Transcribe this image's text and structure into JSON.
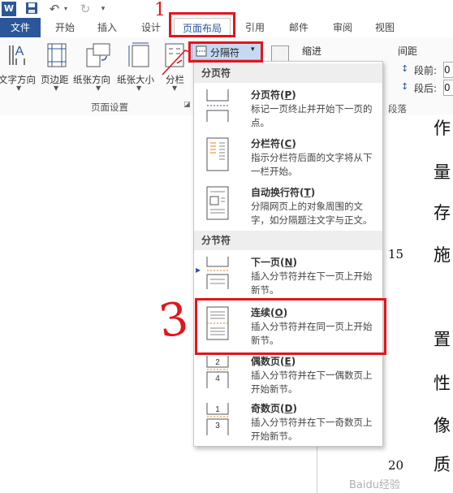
{
  "quick_access": {
    "word_icon": "word-app-icon",
    "save_icon": "save-icon",
    "undo_icon": "undo-icon",
    "redo_icon": "redo-icon",
    "customize_icon": "customize-qat-icon"
  },
  "tabs": [
    {
      "label": "文件"
    },
    {
      "label": "开始"
    },
    {
      "label": "插入"
    },
    {
      "label": "设计"
    },
    {
      "label": "页面布局"
    },
    {
      "label": "引用"
    },
    {
      "label": "邮件"
    },
    {
      "label": "审阅"
    },
    {
      "label": "视图"
    }
  ],
  "ribbon": {
    "buttons": [
      {
        "label": "文字方向",
        "icon": "text-direction-icon"
      },
      {
        "label": "页边距",
        "icon": "margins-icon"
      },
      {
        "label": "纸张方向",
        "icon": "orientation-icon"
      },
      {
        "label": "纸张大小",
        "icon": "size-icon"
      },
      {
        "label": "分栏",
        "icon": "columns-icon"
      }
    ],
    "breaks_button": "分隔符",
    "group_page_setup": "页面设置",
    "indent_label": "缩进",
    "spacing_label": "间距",
    "spacing_before_label": "段前:",
    "spacing_after_label": "段后:",
    "spacing_before_value": "0",
    "spacing_after_value": "0",
    "group_paragraph": "段落"
  },
  "menu": {
    "section_page_breaks": "分页符",
    "section_section_breaks": "分节符",
    "items": [
      {
        "title": "分页符(",
        "key": "P",
        "desc": "标记一页终止并开始下一页的点。"
      },
      {
        "title": "分栏符(",
        "key": "C",
        "desc": "指示分栏符后面的文字将从下一栏开始。"
      },
      {
        "title": "自动换行符(",
        "key": "T",
        "desc": "分隔网页上的对象周围的文字，如分隔题注文字与正文。"
      },
      {
        "title": "下一页(",
        "key": "N",
        "desc": "插入分节符并在下一页上开始新节。"
      },
      {
        "title": "连续(",
        "key": "O",
        "desc": "插入分节符并在同一页上开始新节。"
      },
      {
        "title": "偶数页(",
        "key": "E",
        "desc": "插入分节符并在下一偶数页上开始新节。"
      },
      {
        "title": "奇数页(",
        "key": "D",
        "desc": "插入分节符并在下一奇数页上开始新节。"
      }
    ],
    "close_paren": ")"
  },
  "document": {
    "chars": [
      "作",
      "量",
      "存",
      "施",
      "置",
      "性",
      "像",
      "质"
    ],
    "line_numbers": [
      "15",
      "20"
    ]
  },
  "annotations": {
    "step1": "1",
    "step3": "3",
    "highlight_color": "#e0161b"
  },
  "watermark": "Baidu经验"
}
